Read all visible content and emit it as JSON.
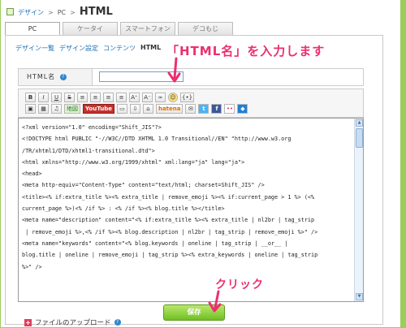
{
  "breadcrumb": {
    "root": "デザイン",
    "sep1": ">",
    "pc": "PC",
    "sep2": ">",
    "current": "HTML"
  },
  "tabs": [
    {
      "label": "PC"
    },
    {
      "label": "ケータイ"
    },
    {
      "label": "スマートフォン"
    },
    {
      "label": "デコもじ"
    }
  ],
  "subnav": {
    "items": [
      "デザイン一覧",
      "デザイン設定",
      "コンテンツ"
    ],
    "current": "HTML"
  },
  "name_field": {
    "label": "HTML名",
    "help": "?",
    "value": ""
  },
  "toolbar": {
    "row1": [
      "B",
      "I",
      "U",
      "S",
      "≡",
      "≡",
      "≡",
      "≡",
      "A⁺",
      "A⁻",
      "∞",
      "☺",
      "{•}"
    ],
    "row2": [
      "▣",
      "▦",
      "♫",
      "地図",
      "YouTube",
      "▭",
      "⇩",
      "⌂",
      "hatena",
      "✉",
      "t",
      "f",
      "••",
      "◆"
    ]
  },
  "code_lines": [
    "<?xml version=\"1.0\" encoding=\"Shift_JIS\"?>",
    "<!DOCTYPE html PUBLIC \"-//W3C//DTD XHTML 1.0 Transitional//EN\" \"http://www.w3.org",
    "/TR/xhtml1/DTD/xhtml1-transitional.dtd\">",
    "<html xmlns=\"http://www.w3.org/1999/xhtml\" xml:lang=\"ja\" lang=\"ja\">",
    "<head>",
    "<meta http-equiv=\"Content-Type\" content=\"text/html; charset=Shift_JIS\" />",
    "<title><% if:extra_title %><% extra_title | remove_emoji %><% if:current_page > 1 %> (<%",
    "current_page %>)<% /if %> : <% /if %><% blog.title %></title>",
    "<meta name=\"description\" content=\"<% if:extra_title %><% extra_title | nl2br | tag_strip",
    " | remove_emoji %>,<% /if %><% blog.description | nl2br | tag_strip | remove_emoji %>\" />",
    "<meta name=\"keywords\" content=\"<% blog.keywords | oneline | tag_strip | __or__ |",
    "blog.title | oneline | remove_emoji | tag_strip %><% extra_keywords | oneline | tag_strip",
    "%>\" />"
  ],
  "upload": {
    "label": "ファイルのアップロード",
    "help": "?"
  },
  "save_button": {
    "label": "保存"
  },
  "annotations": {
    "note1": "「HTML名」を入力します",
    "note2": "クリック"
  },
  "colors": {
    "frame": "#9acd5a",
    "annotation": "#ec2f6f",
    "save": "#6fbf24",
    "link": "#1a6fb5"
  }
}
